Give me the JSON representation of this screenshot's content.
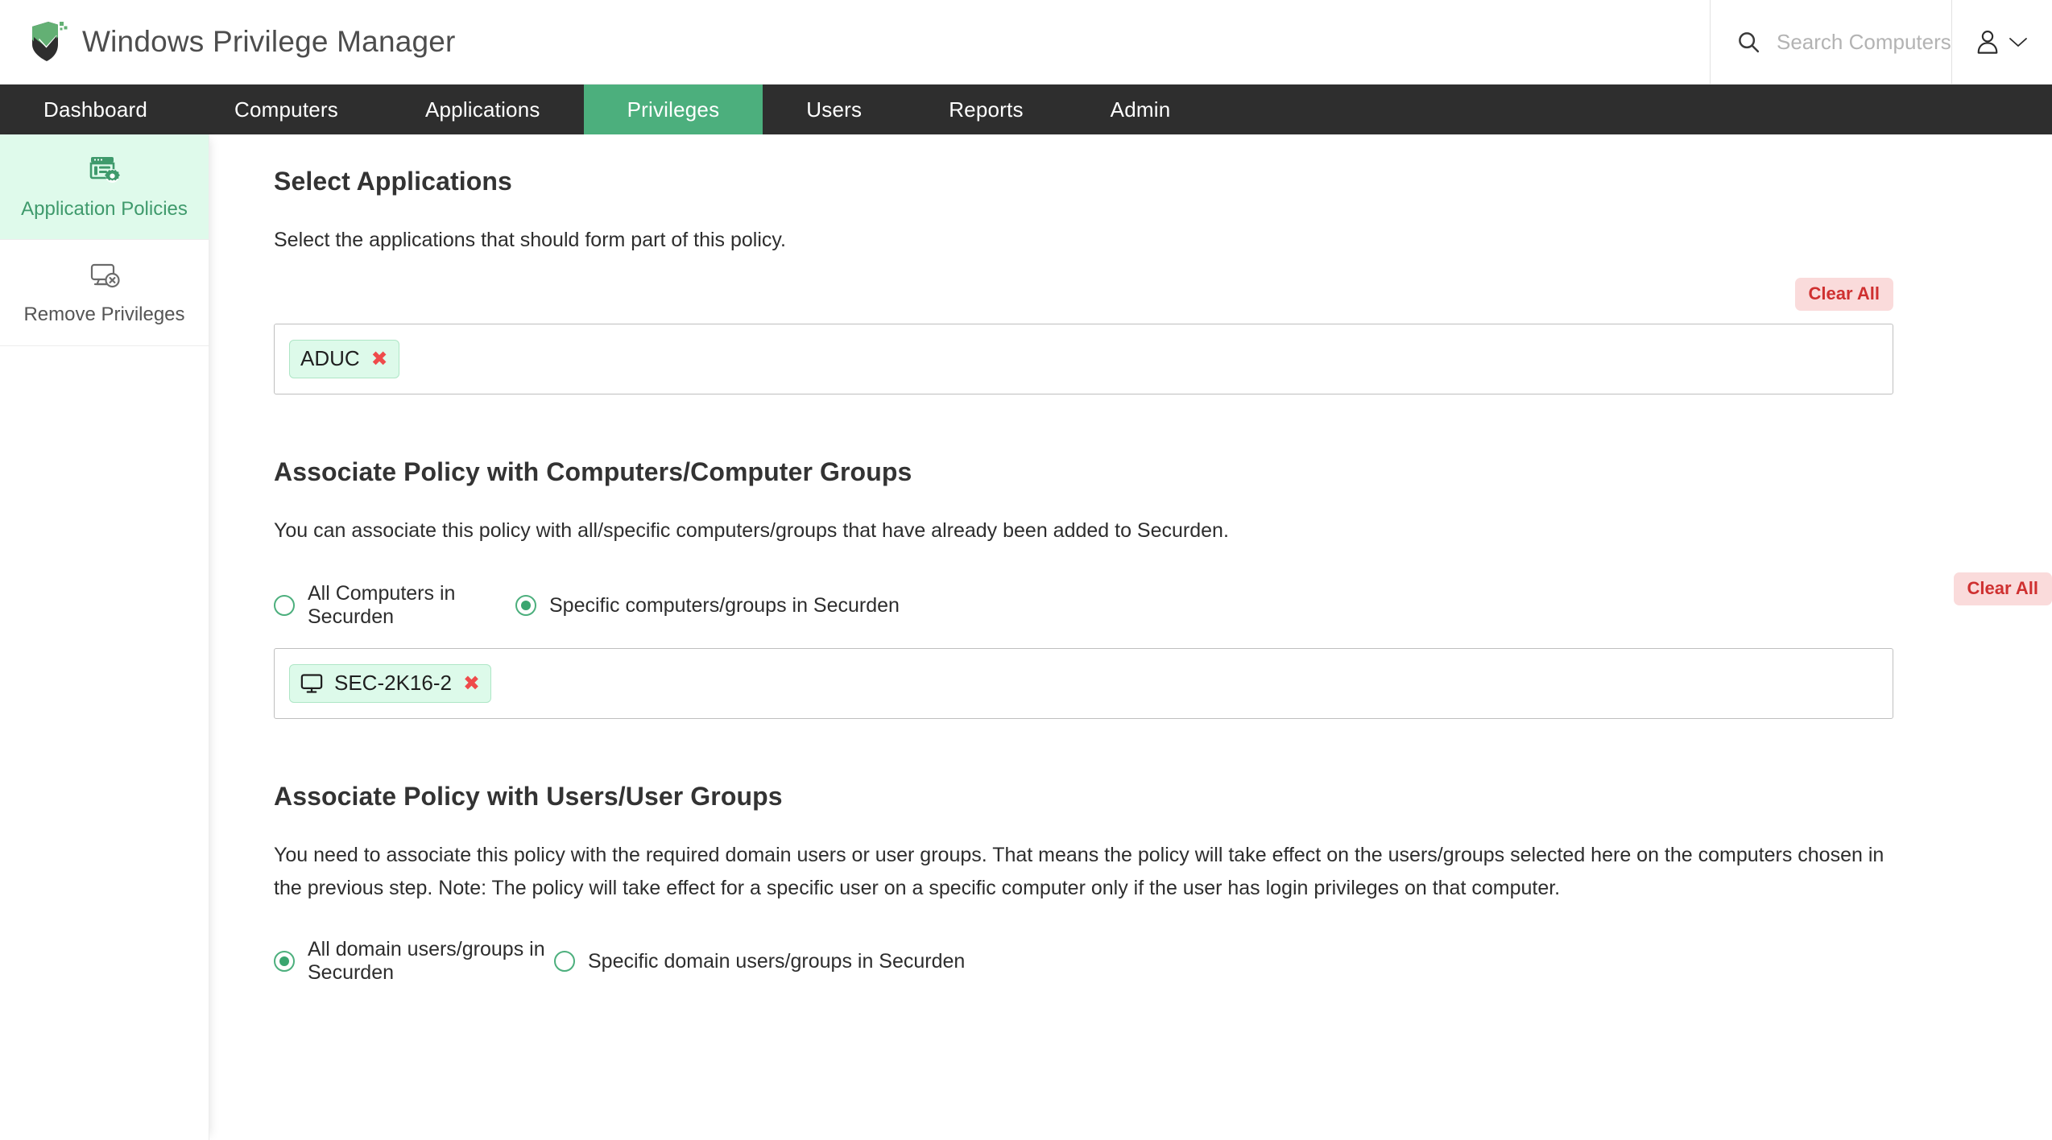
{
  "header": {
    "app_title": "Windows Privilege Manager",
    "logo_icon": "shield-check-icon",
    "search": {
      "icon": "search-icon",
      "placeholder": "Search Computers",
      "value": ""
    },
    "user_menu": {
      "icon": "user-icon",
      "chevron": "chevron-down-icon"
    }
  },
  "nav": {
    "items": [
      {
        "label": "Dashboard",
        "active": false
      },
      {
        "label": "Computers",
        "active": false
      },
      {
        "label": "Applications",
        "active": false
      },
      {
        "label": "Privileges",
        "active": true
      },
      {
        "label": "Users",
        "active": false
      },
      {
        "label": "Reports",
        "active": false
      },
      {
        "label": "Admin",
        "active": false
      }
    ]
  },
  "sidebar": {
    "items": [
      {
        "label": "Application Policies",
        "icon": "application-policies-icon",
        "active": true
      },
      {
        "label": "Remove Privileges",
        "icon": "monitor-remove-icon",
        "active": false
      }
    ]
  },
  "main": {
    "applications_section": {
      "title": "Select Applications",
      "description": "Select the applications that should form part of this policy.",
      "clear_all_label": "Clear All",
      "chips": [
        {
          "label": "ADUC",
          "icon": "",
          "close_icon": "close-icon"
        }
      ]
    },
    "computers_section": {
      "title": "Associate Policy with Computers/Computer Groups",
      "description": "You can associate this policy with all/specific computers/groups that have already been added to Securden.",
      "options": [
        {
          "label": "All Computers in Securden",
          "selected": false
        },
        {
          "label": "Specific computers/groups in Securden",
          "selected": true
        }
      ],
      "clear_all_label": "Clear All",
      "chips": [
        {
          "label": "SEC-2K16-2",
          "icon": "monitor-icon",
          "close_icon": "close-icon"
        }
      ]
    },
    "users_section": {
      "title": "Associate Policy with Users/User Groups",
      "description": "You need to associate this policy with the required domain users or user groups. That means the policy will take effect on the users/groups selected here on the computers chosen in the previous step. Note: The policy will take effect for a specific user on a specific computer only if the user has login privileges on that computer.",
      "options": [
        {
          "label": "All domain users/groups in Securden",
          "selected": true
        },
        {
          "label": "Specific domain users/groups in Securden",
          "selected": false
        }
      ]
    }
  },
  "colors": {
    "accent_green": "#4caf7d",
    "nav_dark": "#2e2e2e",
    "chip_bg": "#ddfaea",
    "clear_all_bg": "#fadbdb",
    "clear_all_text": "#cf3030",
    "close_red": "#ef4b4b"
  }
}
